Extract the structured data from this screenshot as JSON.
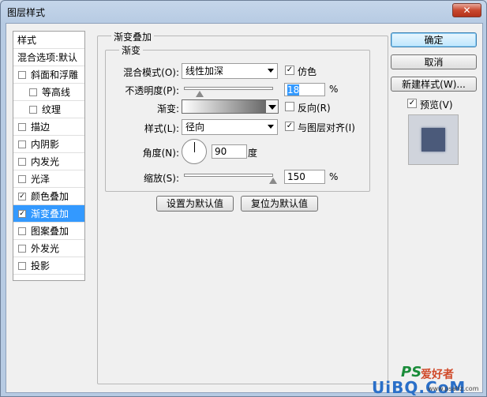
{
  "window": {
    "title": "图层样式",
    "close_label": "✕"
  },
  "side": {
    "items": [
      {
        "label": "样式",
        "checkbox": false,
        "checked": false,
        "indent": 0
      },
      {
        "label": "混合选项:默认",
        "checkbox": false,
        "checked": false,
        "indent": 0
      },
      {
        "label": "斜面和浮雕",
        "checkbox": true,
        "checked": false,
        "indent": 0
      },
      {
        "label": "等高线",
        "checkbox": true,
        "checked": false,
        "indent": 1
      },
      {
        "label": "纹理",
        "checkbox": true,
        "checked": false,
        "indent": 1
      },
      {
        "label": "描边",
        "checkbox": true,
        "checked": false,
        "indent": 0
      },
      {
        "label": "内阴影",
        "checkbox": true,
        "checked": false,
        "indent": 0
      },
      {
        "label": "内发光",
        "checkbox": true,
        "checked": false,
        "indent": 0
      },
      {
        "label": "光泽",
        "checkbox": true,
        "checked": false,
        "indent": 0
      },
      {
        "label": "颜色叠加",
        "checkbox": true,
        "checked": true,
        "indent": 0
      },
      {
        "label": "渐变叠加",
        "checkbox": true,
        "checked": true,
        "indent": 0,
        "active": true
      },
      {
        "label": "图案叠加",
        "checkbox": true,
        "checked": false,
        "indent": 0
      },
      {
        "label": "外发光",
        "checkbox": true,
        "checked": false,
        "indent": 0
      },
      {
        "label": "投影",
        "checkbox": true,
        "checked": false,
        "indent": 0
      }
    ],
    "check_mark": "✓"
  },
  "panel": {
    "group_title": "渐变叠加",
    "sub_title": "渐变",
    "blend_mode_label": "混合模式(O):",
    "blend_mode_value": "线性加深",
    "dither_label": "仿色",
    "dither_checked": true,
    "opacity_label": "不透明度(P):",
    "opacity_value": "18",
    "opacity_unit": "%",
    "opacity_fraction": 0.18,
    "gradient_label": "渐变:",
    "reverse_label": "反向(R)",
    "reverse_checked": false,
    "style_label": "样式(L):",
    "style_value": "径向",
    "align_label": "与图层对齐(I)",
    "align_checked": true,
    "angle_label": "角度(N):",
    "angle_value": "90",
    "angle_unit": "度",
    "scale_label": "缩放(S):",
    "scale_value": "150",
    "scale_unit": "%",
    "scale_fraction": 1.0,
    "make_default_label": "设置为默认值",
    "reset_default_label": "复位为默认值"
  },
  "actions": {
    "ok_label": "确定",
    "cancel_label": "取消",
    "new_style_label": "新建样式(W)...",
    "preview_label": "预览(V)",
    "preview_checked": true
  },
  "colors": {
    "preview_swatch": "#4b5a7a",
    "selection": "#3399ff"
  },
  "watermark": {
    "ps_text": "PS",
    "cn_text": "爱好者",
    "brand_text": "UiBQ.CoM",
    "url_text": "www.psahz.com"
  }
}
